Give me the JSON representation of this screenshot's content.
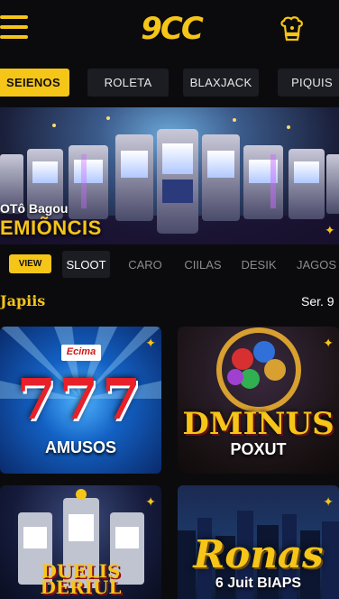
{
  "header": {
    "logo_text": "9CC",
    "menu_icon": "hamburger-icon",
    "profile_icon": "chef-hat-icon"
  },
  "category_tabs": [
    {
      "label": "SEIENOS",
      "active": true
    },
    {
      "label": "ROLETA",
      "active": false
    },
    {
      "label": "BLAXJACK",
      "active": false
    },
    {
      "label": "PIQUIS",
      "active": false
    }
  ],
  "banner": {
    "title": "OTô Bagou",
    "subtitle": "EMIÕNCIS"
  },
  "filter": {
    "view_label": "VIEW",
    "tabs": [
      {
        "label": "SLOOT",
        "active": true
      },
      {
        "label": "CARO",
        "active": false
      },
      {
        "label": "CIILAS",
        "active": false
      },
      {
        "label": "DESIK",
        "active": false
      },
      {
        "label": "JAGOS",
        "active": false
      }
    ]
  },
  "section": {
    "title": "Japiis",
    "see_all": "Ser. 9"
  },
  "games": [
    {
      "badge": "Ecima",
      "title": "777",
      "subtitle": "AMUSOS"
    },
    {
      "title": "DMINUS",
      "subtitle": "POXUT"
    },
    {
      "title": "DUELIS DERIUL"
    },
    {
      "title": "Ronas",
      "subtitle": "6 Juit BIAPS"
    }
  ],
  "colors": {
    "accent": "#f5c518",
    "background": "#0b0b0d",
    "tab_bg": "#1c1d22"
  }
}
